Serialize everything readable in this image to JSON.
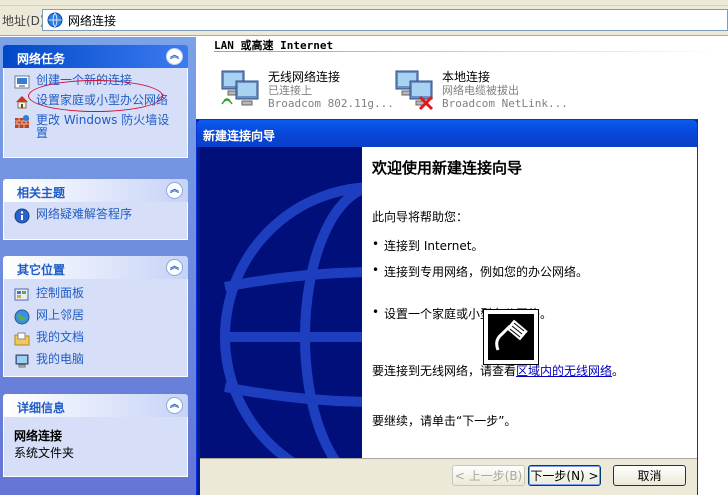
{
  "address": {
    "label": "地址(D)",
    "value": "网络连接"
  },
  "taskpane": {
    "network_tasks": {
      "title": "网络任务",
      "items": [
        {
          "label": "创建一个新的连接"
        },
        {
          "label": "设置家庭或小型办公网络"
        },
        {
          "label": "更改 Windows 防火墙设置"
        }
      ]
    },
    "see_also": {
      "title": "相关主题",
      "items": [
        {
          "label": "网络疑难解答程序"
        }
      ]
    },
    "other_places": {
      "title": "其它位置",
      "items": [
        {
          "label": "控制面板"
        },
        {
          "label": "网上邻居"
        },
        {
          "label": "我的文档"
        },
        {
          "label": "我的电脑"
        }
      ]
    },
    "details": {
      "title": "详细信息",
      "name": "网络连接",
      "type": "系统文件夹"
    }
  },
  "content": {
    "group_title": "LAN 或高速 Internet",
    "connections": [
      {
        "name": "无线网络连接",
        "status": "已连接上",
        "device": "Broadcom 802.11g..."
      },
      {
        "name": "本地连接",
        "status": "网络电缆被拔出",
        "device": "Broadcom NetLink..."
      }
    ]
  },
  "wizard": {
    "title": "新建连接向导",
    "heading": "欢迎使用新建连接向导",
    "intro": "此向导将帮助您：",
    "bullets": [
      "连接到 Internet。",
      "连接到专用网络，例如您的办公网络。",
      "设置一个家庭或小型办公网络。"
    ],
    "wireless_prefix": "要连接到无线网络，请查看",
    "wireless_link": "区域内的无线网络",
    "wireless_suffix": "。",
    "continue_text": "要继续，请单击“下一步”。",
    "buttons": {
      "back": "< 上一步(B)",
      "next": "下一步(N) >",
      "cancel": "取消"
    }
  }
}
